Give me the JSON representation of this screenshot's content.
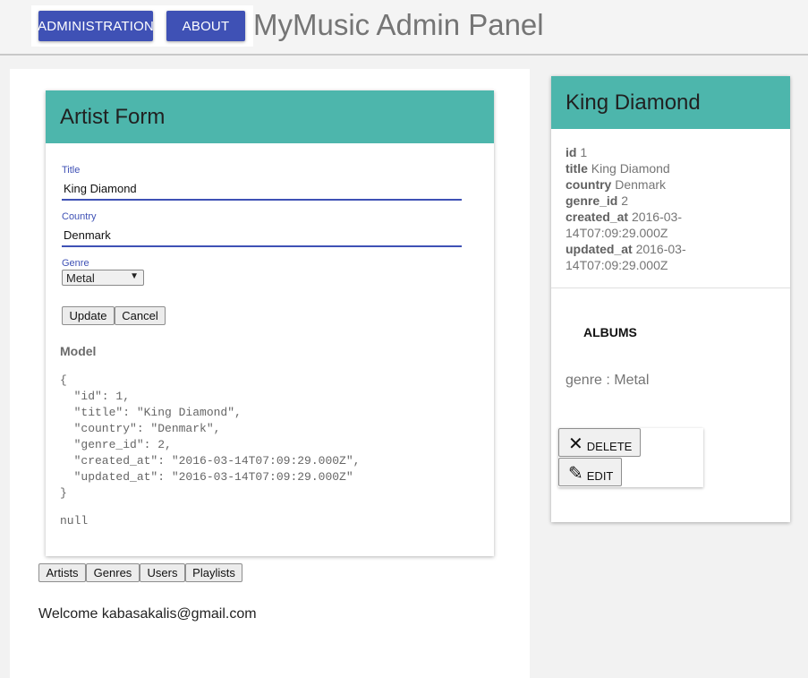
{
  "header": {
    "nav_buttons": [
      "Administration",
      "About"
    ],
    "app_title": "MyMusic Admin Panel"
  },
  "artist_form": {
    "title": "Artist Form",
    "title_label": "Title",
    "title_value": "King Diamond",
    "country_label": "Country",
    "country_value": "Denmark",
    "genre_label": "Genre",
    "genre_selected": "Metal",
    "update_label": "Update",
    "cancel_label": "Cancel",
    "model_title": "Model",
    "model_json": "{\n  \"id\": 1,\n  \"title\": \"King Diamond\",\n  \"country\": \"Denmark\",\n  \"genre_id\": 2,\n  \"created_at\": \"2016-03-14T07:09:29.000Z\",\n  \"updated_at\": \"2016-03-14T07:09:29.000Z\"\n}",
    "null_text": "null"
  },
  "bottom_tabs": [
    "Artists",
    "Genres",
    "Users",
    "Playlists"
  ],
  "welcome_text": "Welcome kabasakalis@gmail.com",
  "artist_detail": {
    "name": "King Diamond",
    "attributes": [
      {
        "key": "id",
        "value": "1"
      },
      {
        "key": "title",
        "value": "King Diamond"
      },
      {
        "key": "country",
        "value": "Denmark"
      },
      {
        "key": "genre_id",
        "value": "2"
      },
      {
        "key": "created_at",
        "value": "2016-03-14T07:09:29.000Z"
      },
      {
        "key": "updated_at",
        "value": "2016-03-14T07:09:29.000Z"
      }
    ],
    "albums_label": "ALBUMS",
    "genre_line": "genre : Metal",
    "delete_label": "DELETE",
    "edit_label": "EDIT"
  },
  "colors": {
    "primary": "#3f51b5",
    "teal_header": "#4db6ac"
  },
  "icons": {
    "delete": "close-icon",
    "edit": "pencil-icon"
  }
}
